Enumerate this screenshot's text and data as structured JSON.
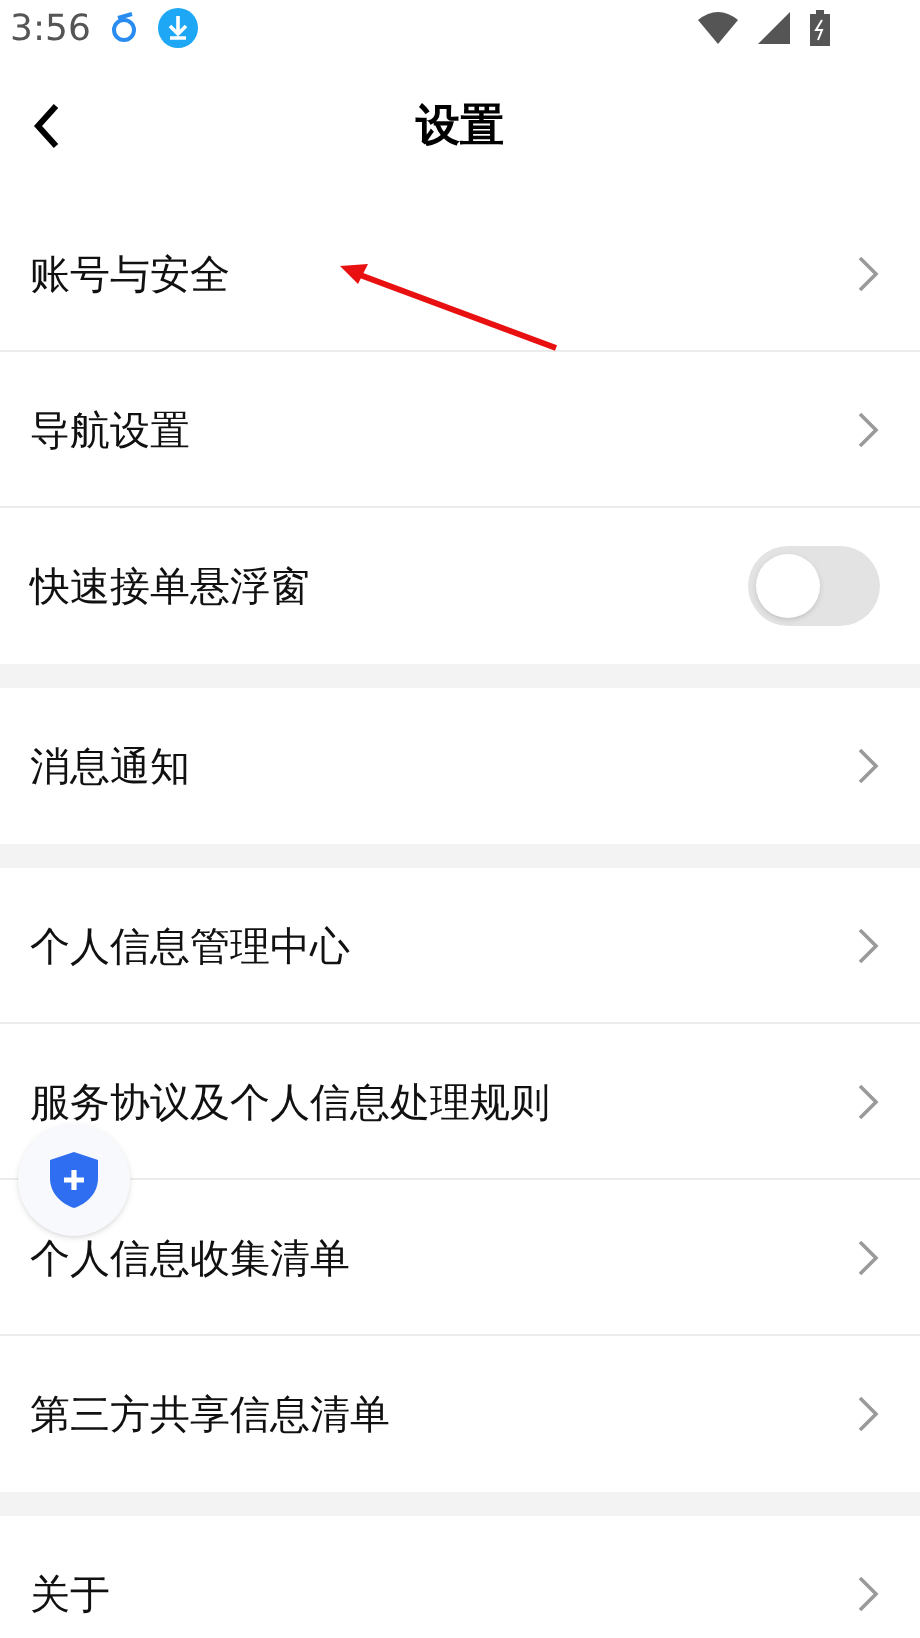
{
  "status_bar": {
    "time": "3:56"
  },
  "header": {
    "title": "设置"
  },
  "sections": [
    {
      "items": [
        {
          "label": "账号与安全",
          "kind": "link"
        },
        {
          "label": "导航设置",
          "kind": "link"
        },
        {
          "label": "快速接单悬浮窗",
          "kind": "toggle",
          "on": false
        }
      ]
    },
    {
      "items": [
        {
          "label": "消息通知",
          "kind": "link"
        }
      ]
    },
    {
      "items": [
        {
          "label": "个人信息管理中心",
          "kind": "link"
        },
        {
          "label": "服务协议及个人信息处理规则",
          "kind": "link"
        },
        {
          "label": "个人信息收集清单",
          "kind": "link"
        },
        {
          "label": "第三方共享信息清单",
          "kind": "link"
        }
      ]
    },
    {
      "items": [
        {
          "label": "关于",
          "kind": "link"
        }
      ]
    }
  ]
}
